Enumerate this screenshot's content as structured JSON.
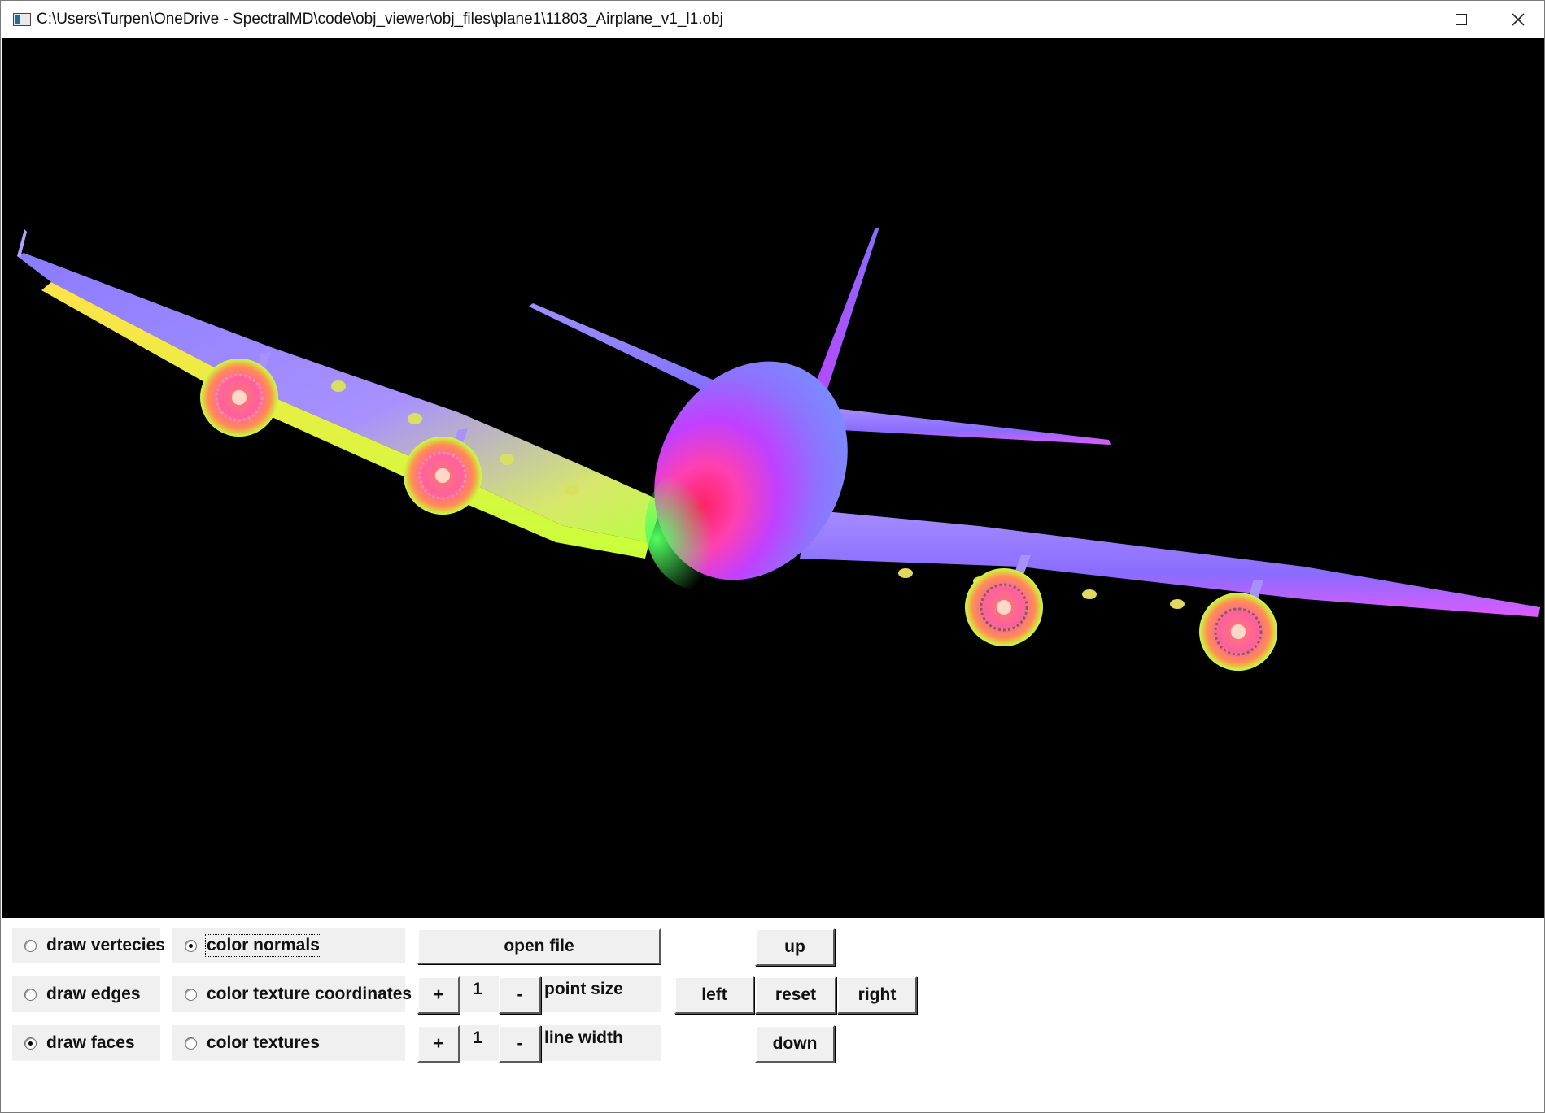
{
  "window": {
    "title": "C:\\Users\\Turpen\\OneDrive - SpectralMD\\code\\obj_viewer\\obj_files\\plane1\\11803_Airplane_v1_l1.obj",
    "icon": "app-window-icon"
  },
  "render_modes": [
    {
      "label": "draw vertecies",
      "checked": false
    },
    {
      "label": "draw edges",
      "checked": false
    },
    {
      "label": "draw faces",
      "checked": true
    }
  ],
  "color_modes": [
    {
      "label": "color normals",
      "checked": true
    },
    {
      "label": "color texture coordinates",
      "checked": false
    },
    {
      "label": "color textures",
      "checked": false
    }
  ],
  "open_file_label": "open file",
  "point_size": {
    "plus": "+",
    "value": "1",
    "minus": "-",
    "label": "point size"
  },
  "line_width": {
    "plus": "+",
    "value": "1",
    "minus": "-",
    "label": "line width"
  },
  "camera": {
    "up": "up",
    "left": "left",
    "reset": "reset",
    "right": "right",
    "down": "down"
  },
  "colors": {
    "viewport_bg": "#000000",
    "panel_bg": "#f0f0f0"
  }
}
